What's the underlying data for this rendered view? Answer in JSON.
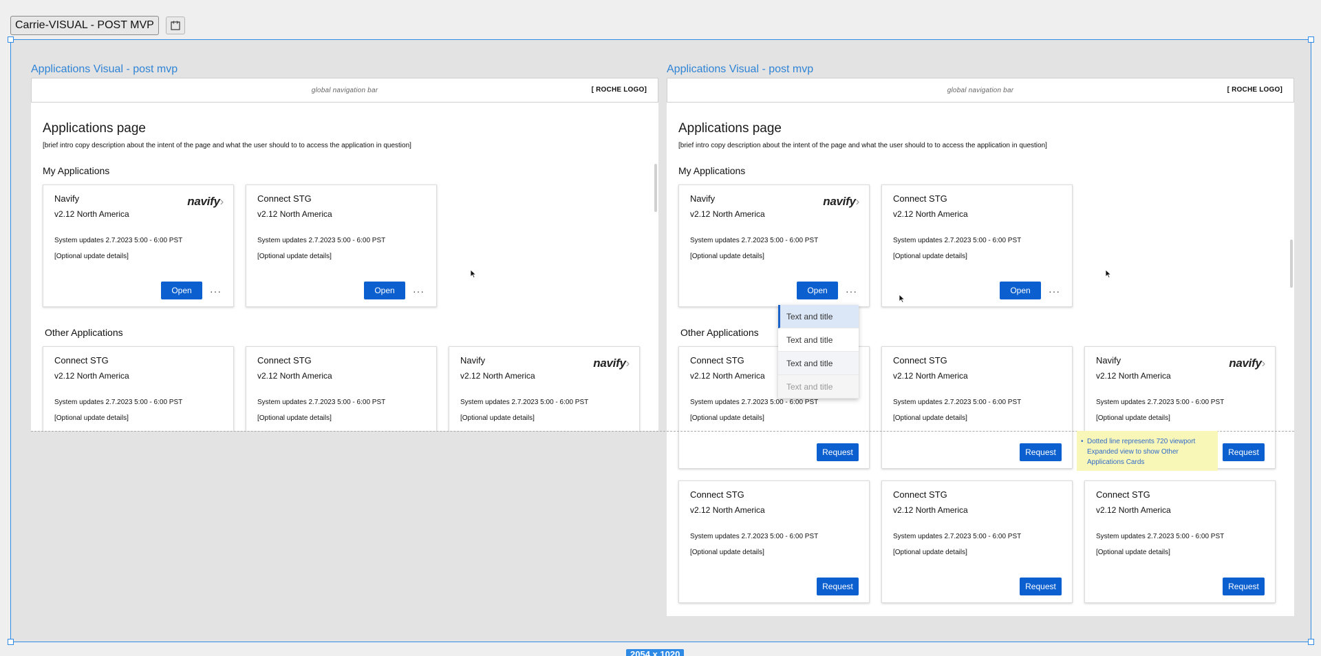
{
  "frame_label": "Carrie-VISUAL - POST MVP",
  "size_badge": "2054 x 1020",
  "boards": [
    {
      "title": "Applications Visual - post mvp",
      "nav_text": "global navigation bar",
      "logo_text": "[ ROCHE LOGO]",
      "page_title": "Applications page",
      "intro": "[brief intro copy description about the intent of the page and what the user should to to access the application in question]",
      "my_apps_title": "My Applications",
      "other_apps_title": "Other Applications"
    },
    {
      "title": "Applications Visual - post mvp",
      "nav_text": "global navigation bar",
      "logo_text": "[ ROCHE LOGO]",
      "page_title": "Applications page",
      "intro": "[brief intro copy description about the intent of the page and what the user should to to access the application in question]",
      "my_apps_title": "My Applications",
      "other_apps_title": "Other Applications"
    }
  ],
  "cards": {
    "navify": {
      "name": "Navify",
      "version": "v2.12 North America",
      "updates": "System updates 2.7.2023  5:00 - 6:00 PST",
      "optional": "[Optional update details]",
      "logo": "navify"
    },
    "connect": {
      "name": "Connect STG",
      "version": "v2.12 North America",
      "updates": "System updates 2.7.2023  5:00 - 6:00 PST",
      "optional": "[Optional update details]"
    }
  },
  "buttons": {
    "open": "Open",
    "request": "Request",
    "more": "···"
  },
  "menu": [
    "Text and title",
    "Text and title",
    "Text and title",
    "Text and title"
  ],
  "note": "Dotted line represents 720 viewport Expanded view to show Other Applications Cards",
  "colors": {
    "accent": "#0b5fcf",
    "selection": "#2f8ae6",
    "link_title": "#2f84d6",
    "note_bg": "#f9f7b8"
  }
}
